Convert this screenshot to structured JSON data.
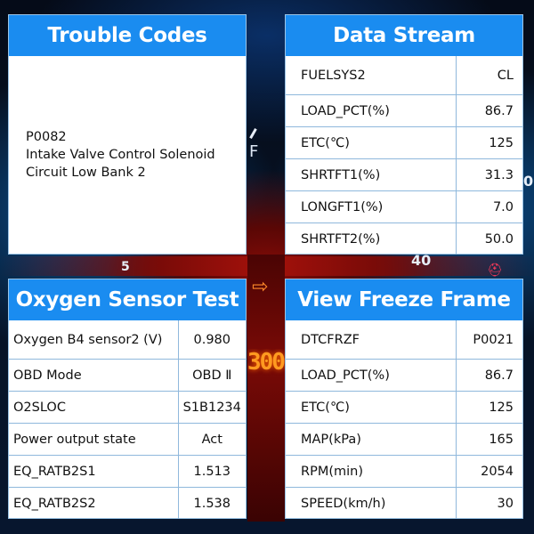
{
  "background": {
    "gauge_f_label": "F",
    "gauge_40_label": "40",
    "gauge_5_label": "5",
    "odometer_digits": "300",
    "arrow_glyph": "⇨",
    "right_edge_digit": "0"
  },
  "colors": {
    "header_blue": "#1a8cf0",
    "panel_bg": "#ffffff",
    "grid_line": "#8fb8dc"
  },
  "trouble_codes": {
    "title": "Trouble Codes",
    "code": "P0082",
    "description_line1": "Intake Valve Control Solenoid",
    "description_line2": "Circuit Low Bank 2"
  },
  "data_stream": {
    "title": "Data Stream",
    "rows": [
      {
        "label": "FUELSYS2",
        "value": "CL"
      },
      {
        "label": "LOAD_PCT(%)",
        "value": "86.7"
      },
      {
        "label": "ETC(℃)",
        "value": "125"
      },
      {
        "label": "SHRTFT1(%)",
        "value": "31.3"
      },
      {
        "label": "LONGFT1(%)",
        "value": "7.0"
      },
      {
        "label": "SHRTFT2(%)",
        "value": "50.0"
      }
    ]
  },
  "oxygen_sensor_test": {
    "title": "Oxygen Sensor Test",
    "rows": [
      {
        "label": "Oxygen B4 sensor2 (V)",
        "value": "0.980"
      },
      {
        "label": "OBD Mode",
        "value": "OBD Ⅱ"
      },
      {
        "label": "O2SLOC",
        "value": "S1B1234"
      },
      {
        "label": "Power output state",
        "value": "Act"
      },
      {
        "label": "EQ_RATB2S1",
        "value": "1.513"
      },
      {
        "label": "EQ_RATB2S2",
        "value": "1.538"
      }
    ]
  },
  "view_freeze_frame": {
    "title": "View Freeze Frame",
    "rows": [
      {
        "label": "DTCFRZF",
        "value": "P0021"
      },
      {
        "label": "LOAD_PCT(%)",
        "value": "86.7"
      },
      {
        "label": "ETC(℃)",
        "value": "125"
      },
      {
        "label": "MAP(kPa)",
        "value": "165"
      },
      {
        "label": "RPM(min)",
        "value": "2054"
      },
      {
        "label": "SPEED(km/h)",
        "value": "30"
      }
    ]
  }
}
